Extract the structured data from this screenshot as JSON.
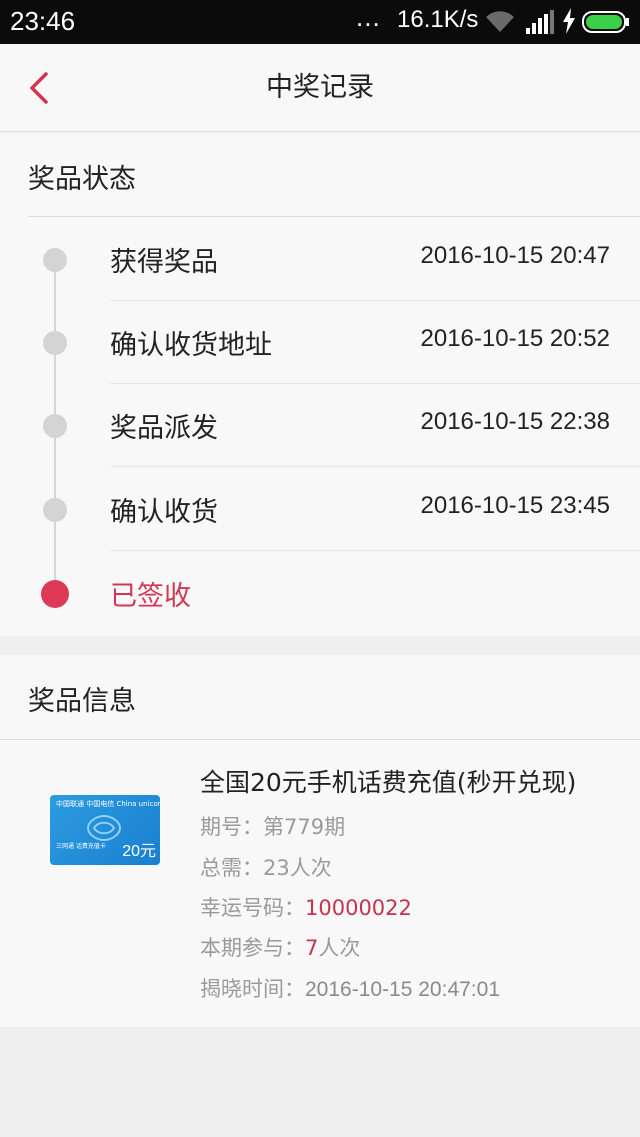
{
  "status_bar": {
    "time": "23:46",
    "dots": "...",
    "net_speed": "16.1K/s"
  },
  "nav": {
    "title": "中奖记录",
    "back_icon": "chevron-left-icon"
  },
  "prize_status": {
    "title": "奖品状态",
    "steps": [
      {
        "label": "获得奖品",
        "time": "2016-10-15 20:47"
      },
      {
        "label": "确认收货地址",
        "time": "2016-10-15 20:52"
      },
      {
        "label": "奖品派发",
        "time": "2016-10-15 22:38"
      },
      {
        "label": "确认收货",
        "time": "2016-10-15 23:45"
      },
      {
        "label": "已签收",
        "time": ""
      }
    ],
    "active_color": "#dc3a57"
  },
  "prize_info": {
    "title": "奖品信息",
    "image": {
      "brand_text": "中国联通 中国电信 China unicom",
      "card_text": "三网通 话费充值卡",
      "amount": "20元"
    },
    "name": "全国20元手机话费充值(秒开兑现)",
    "period_label": "期号：",
    "period_value": "第779期",
    "total_label": "总需：",
    "total_value": "23人次",
    "lucky_label": "幸运号码：",
    "lucky_value": "10000022",
    "join_label": "本期参与：",
    "join_value": "7",
    "join_unit": "人次",
    "reveal_label": "揭晓时间：",
    "reveal_value": "2016-10-15 20:47:01"
  }
}
